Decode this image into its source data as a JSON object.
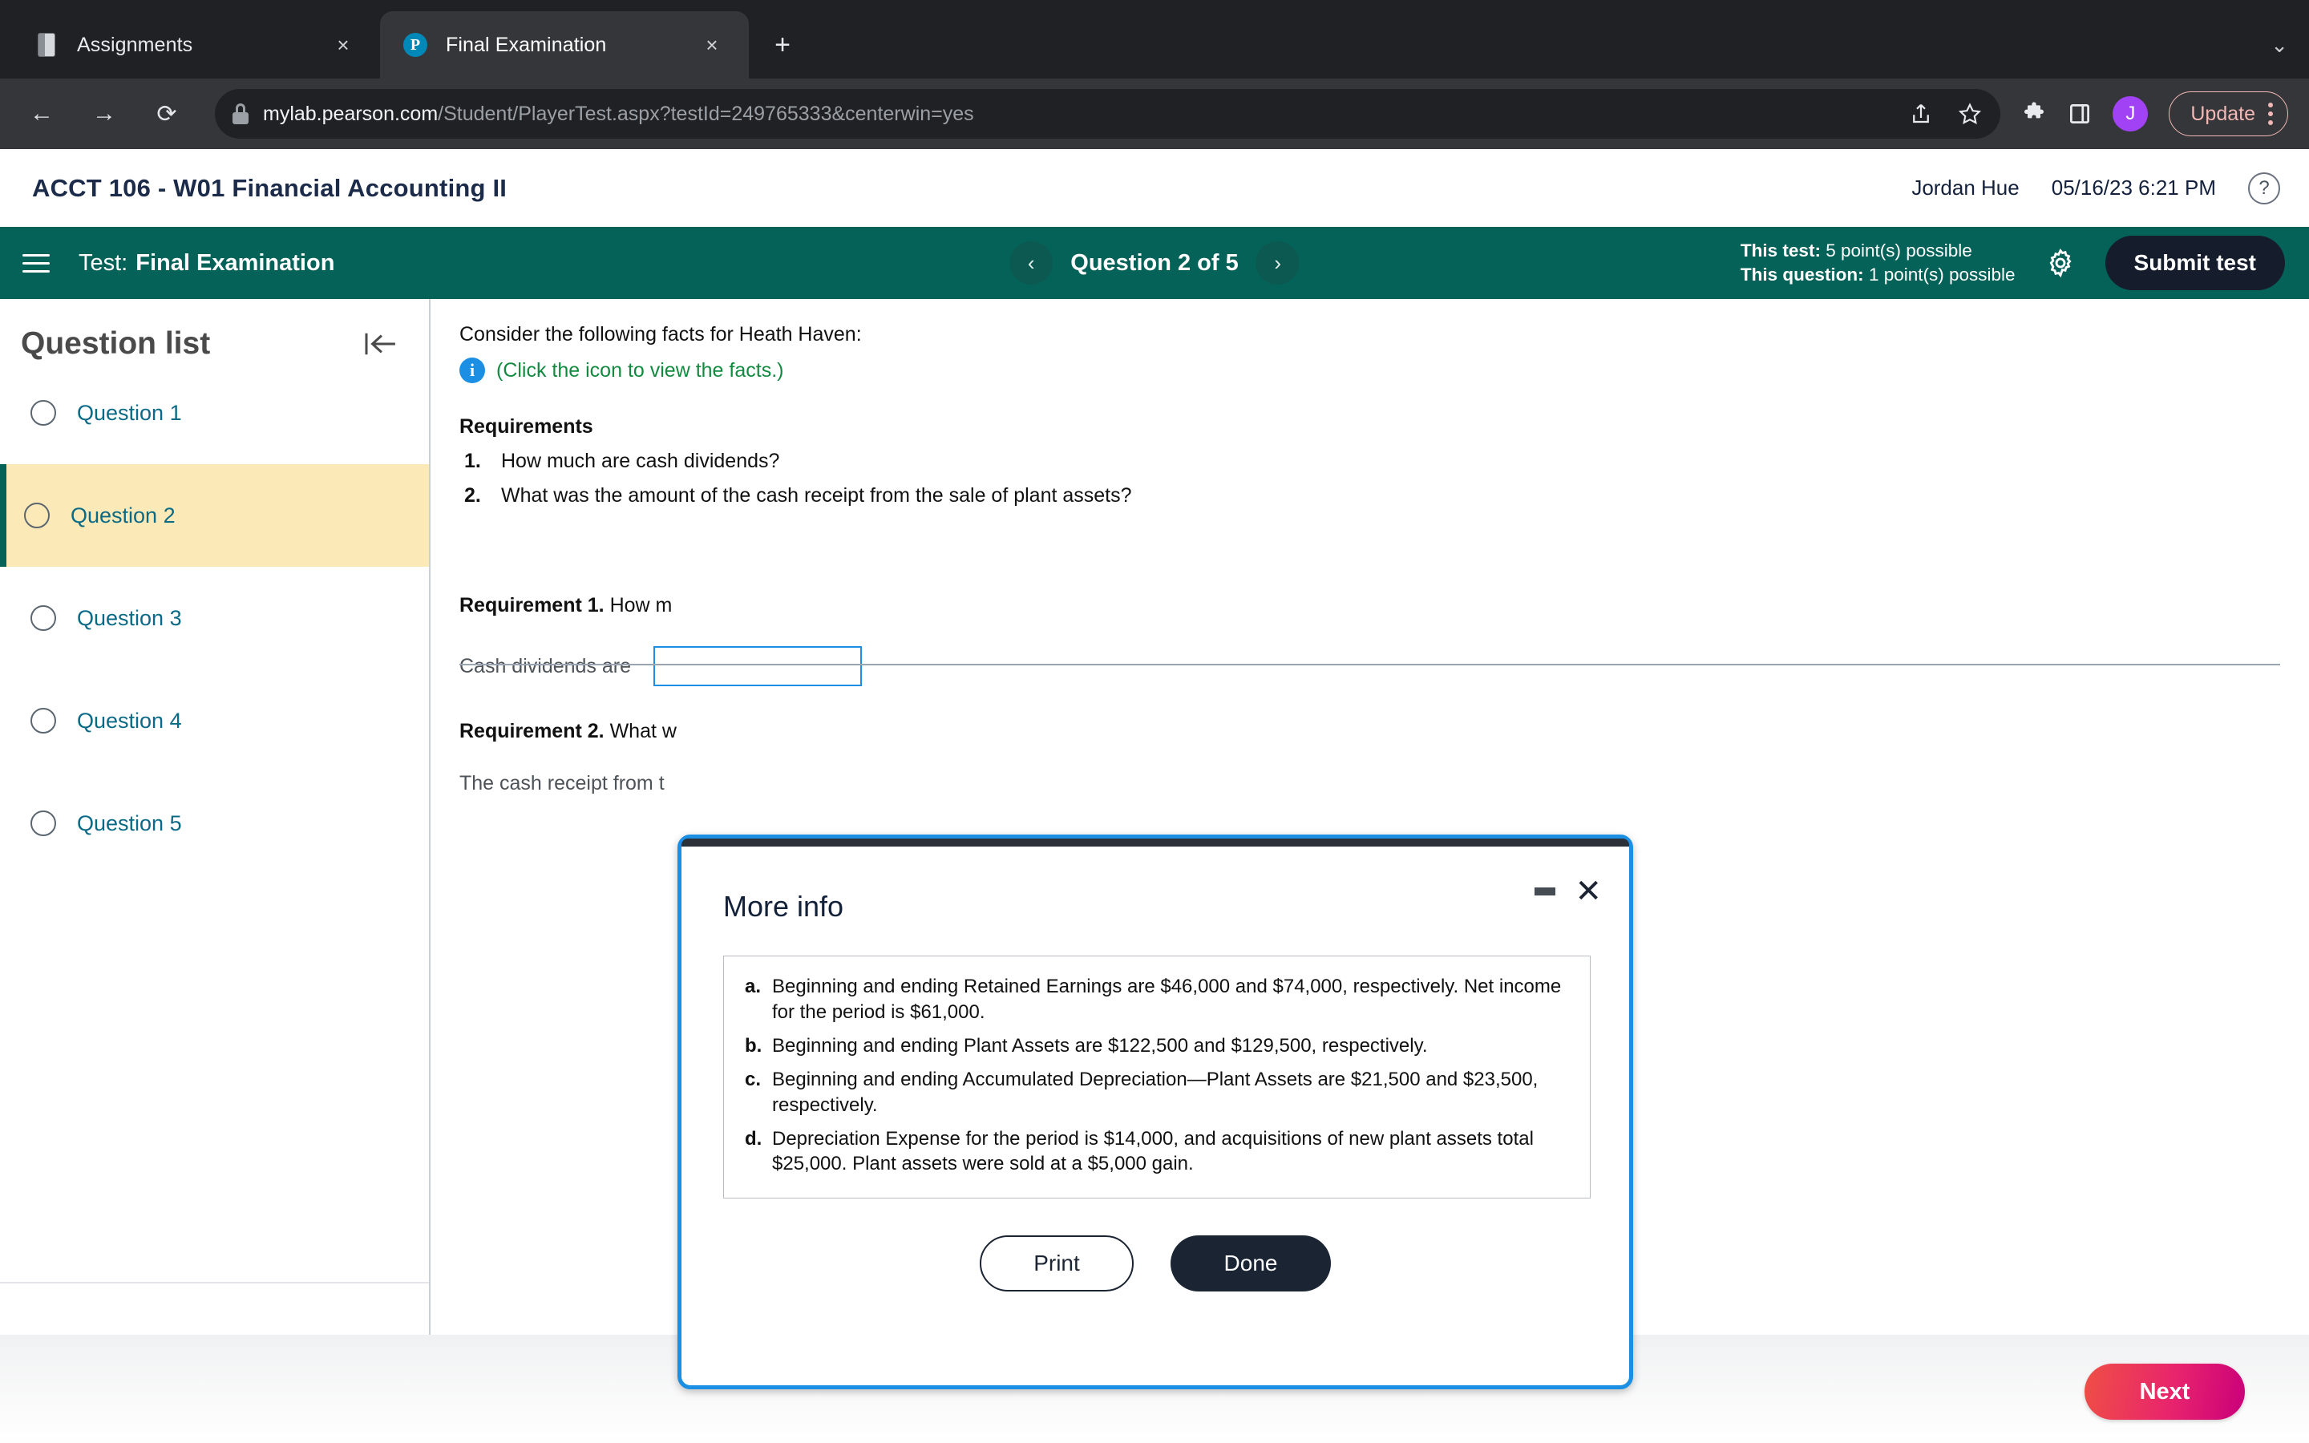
{
  "browser": {
    "tabs": [
      {
        "title": "Assignments",
        "favicon": "book-icon",
        "active": false,
        "close_label": "×"
      },
      {
        "title": "Final Examination",
        "favicon": "pearson-icon",
        "active": true,
        "close_label": "×"
      }
    ],
    "new_tab_label": "+",
    "tab_list_chevron": "⌄",
    "back_label": "←",
    "forward_label": "→",
    "reload_label": "⟳",
    "url_host": "mylab.pearson.com",
    "url_path": "/Student/PlayerTest.aspx?testId=249765333&centerwin=yes",
    "share_icon": "share-icon",
    "bookmark_icon": "star-icon",
    "extensions_icon": "puzzle-icon",
    "sidepanel_icon": "side-panel-icon",
    "profile_initial": "J",
    "update_label": "Update",
    "menu_icon": "kebab-menu-icon"
  },
  "app_header": {
    "course_title": "ACCT 106 - W01 Financial Accounting II",
    "user_name": "Jordan Hue",
    "timestamp": "05/16/23 6:21 PM",
    "help_label": "?"
  },
  "test_bar": {
    "menu_icon": "hamburger-icon",
    "test_label": "Test:",
    "test_name": "Final Examination",
    "prev_label": "‹",
    "next_label": "›",
    "question_counter": "Question 2 of 5",
    "points_test_label": "This test:",
    "points_test_value": "5 point(s) possible",
    "points_question_label": "This question:",
    "points_question_value": "1 point(s) possible",
    "settings_icon": "gear-icon",
    "submit_label": "Submit test"
  },
  "sidebar": {
    "title": "Question list",
    "collapse_icon": "collapse-panel-icon",
    "items": [
      {
        "label": "Question 1",
        "active": false
      },
      {
        "label": "Question 2",
        "active": true
      },
      {
        "label": "Question 3",
        "active": false
      },
      {
        "label": "Question 4",
        "active": false
      },
      {
        "label": "Question 5",
        "active": false
      }
    ]
  },
  "question": {
    "intro": "Consider the following facts for Heath Haven:",
    "info_icon": "info-icon",
    "click_icon_text": "(Click the icon to view the facts.)",
    "requirements_heading": "Requirements",
    "requirements": [
      {
        "num": "1.",
        "text": "How much are cash dividends?"
      },
      {
        "num": "2.",
        "text": "What was the amount of the cash receipt from the sale of plant assets?"
      }
    ],
    "req1_label": "Requirement 1.",
    "req1_text": "How m",
    "answer1_label": "Cash dividends are",
    "answer1_value": "",
    "req2_label": "Requirement 2.",
    "req2_text": "What w",
    "answer2_label": "The cash receipt from t"
  },
  "modal": {
    "title": "More info",
    "minimize_icon": "minimize-icon",
    "close_icon": "close-icon",
    "facts": [
      {
        "key": "a.",
        "text": "Beginning and ending Retained Earnings are $46,000 and $74,000, respectively. Net income for the period is $61,000."
      },
      {
        "key": "b.",
        "text": "Beginning and ending Plant Assets are $122,500 and $129,500, respectively."
      },
      {
        "key": "c.",
        "text": "Beginning and ending Accumulated Depreciation—Plant Assets are $21,500 and $23,500, respectively."
      },
      {
        "key": "d.",
        "text": "Depreciation Expense for the period is $14,000, and acquisitions of new plant assets total $25,000. Plant assets were sold at a $5,000 gain."
      }
    ],
    "print_label": "Print",
    "done_label": "Done"
  },
  "footer": {
    "next_label": "Next"
  },
  "colors": {
    "teal": "#056258",
    "accent_blue": "#1a8fe3",
    "link_blue": "#0b6a86",
    "highlight_yellow": "#fbe9b7",
    "dark_navy": "#1b2433",
    "next_gradient_start": "#ef4f45",
    "next_gradient_end": "#c9007a",
    "green_text": "#128a3f"
  }
}
